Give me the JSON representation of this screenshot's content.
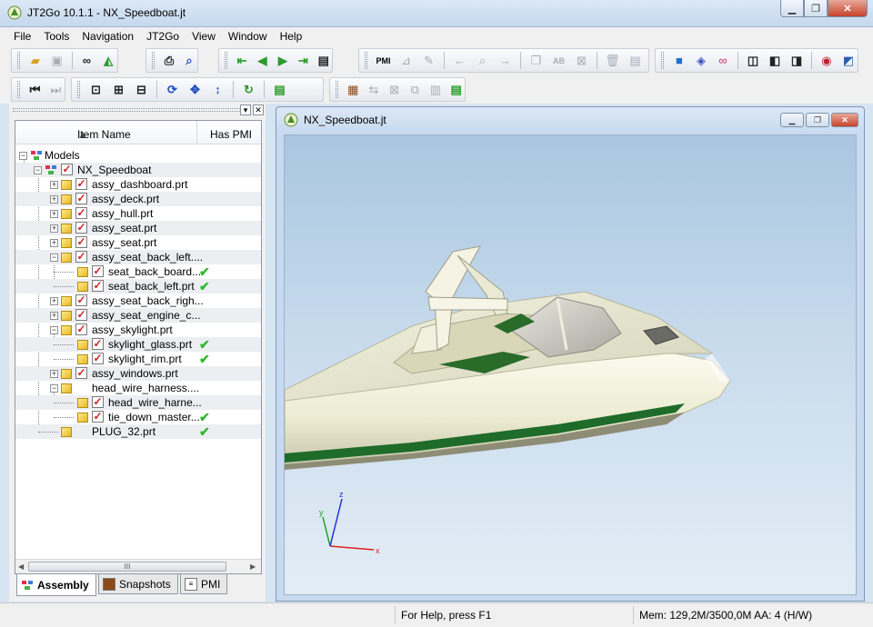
{
  "window": {
    "title": "JT2Go 10.1.1 - NX_Speedboat.jt",
    "min_symbol": "▁",
    "max_symbol": "❐",
    "close_symbol": "✕"
  },
  "menu": [
    "File",
    "Tools",
    "Navigation",
    "JT2Go",
    "View",
    "Window",
    "Help"
  ],
  "toolbar": {
    "pmi_label": "PMI",
    "abc_label": "AB"
  },
  "tree": {
    "col_item_name": "Item Name",
    "col_has_pmi": "Has PMI",
    "items": [
      {
        "label": "Models"
      },
      {
        "label": "NX_Speedboat"
      },
      {
        "label": "assy_dashboard.prt"
      },
      {
        "label": "assy_deck.prt"
      },
      {
        "label": "assy_hull.prt"
      },
      {
        "label": "assy_seat.prt"
      },
      {
        "label": "assy_seat.prt"
      },
      {
        "label": "assy_seat_back_left...."
      },
      {
        "label": "seat_back_board..."
      },
      {
        "label": "seat_back_left.prt"
      },
      {
        "label": "assy_seat_back_righ..."
      },
      {
        "label": "assy_seat_engine_c..."
      },
      {
        "label": "assy_skylight.prt"
      },
      {
        "label": "skylight_glass.prt"
      },
      {
        "label": "skylight_rim.prt"
      },
      {
        "label": "assy_windows.prt"
      },
      {
        "label": "head_wire_harness...."
      },
      {
        "label": "head_wire_harne..."
      },
      {
        "label": "tie_down_master..."
      },
      {
        "label": "PLUG_32.prt"
      }
    ],
    "scroll_grip": "III"
  },
  "tabs": [
    {
      "label": "Assembly",
      "active": true
    },
    {
      "label": "Snapshots",
      "active": false
    },
    {
      "label": "PMI",
      "active": false
    }
  ],
  "viewer": {
    "title": "NX_Speedboat.jt",
    "axes": {
      "x": "x",
      "y": "y",
      "z": "z"
    }
  },
  "status": {
    "help": "For Help, press F1",
    "memory": "Mem: 129,2M/3500,0M  AA: 4 (H/W)"
  },
  "colors": {
    "tree_check": "#d0202a",
    "pmi_check": "#2fb82f",
    "hull": "#efeed8",
    "stripe": "#1f6b2a"
  }
}
